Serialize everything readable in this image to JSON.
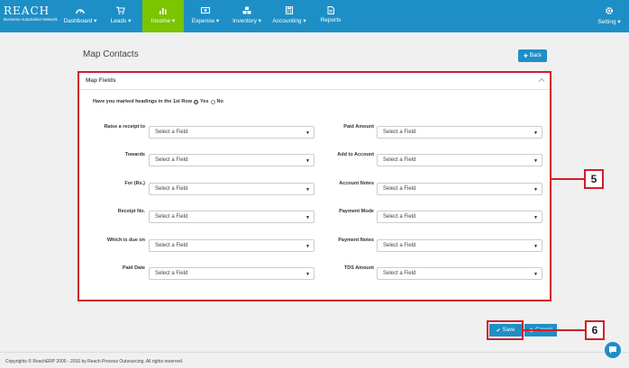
{
  "brand": {
    "name": "REACH",
    "tagline": "Business Automation Network"
  },
  "nav": [
    {
      "label": "Dashboard ▾",
      "icon": "speedometer-icon"
    },
    {
      "label": "Leads ▾",
      "icon": "cart-icon"
    },
    {
      "label": "Income ▾",
      "icon": "bar-chart-icon",
      "active": true
    },
    {
      "label": "Expense ▾",
      "icon": "money-icon"
    },
    {
      "label": "Inventory ▾",
      "icon": "cubes-icon"
    },
    {
      "label": "Accounting ▾",
      "icon": "calculator-icon"
    },
    {
      "label": "Reports",
      "icon": "document-icon"
    }
  ],
  "setting_label": "Setting ▾",
  "page_title": "Map Contacts",
  "back_label": "Back",
  "panel": {
    "title": "Map Fields",
    "heading_question": "Have you marked headings in the 1st Row",
    "yes_label": "Yes",
    "no_label": "No",
    "selected_heading_option": "Yes",
    "select_placeholder": "Select a Field"
  },
  "fields_left": [
    "Raise a receipt to",
    "Towards",
    "For (Rs.)",
    "Receipt No.",
    "Which is due on",
    "Paid Date"
  ],
  "fields_right": [
    "Paid Amount",
    "Add to Account",
    "Account Notes",
    "Payment Mode",
    "Payment Notes",
    "TDS Amount"
  ],
  "callouts": {
    "panel": "5",
    "save": "6"
  },
  "save_label": "Save",
  "cancel_label": "Cancel",
  "footer": "Copyrights © ReachERP 2005 - 2016 by Reach Process Outsourcing. All rights reserved.",
  "colors": {
    "nav": "#1e8fc6",
    "active": "#7bc400",
    "callout": "#d0202a"
  }
}
